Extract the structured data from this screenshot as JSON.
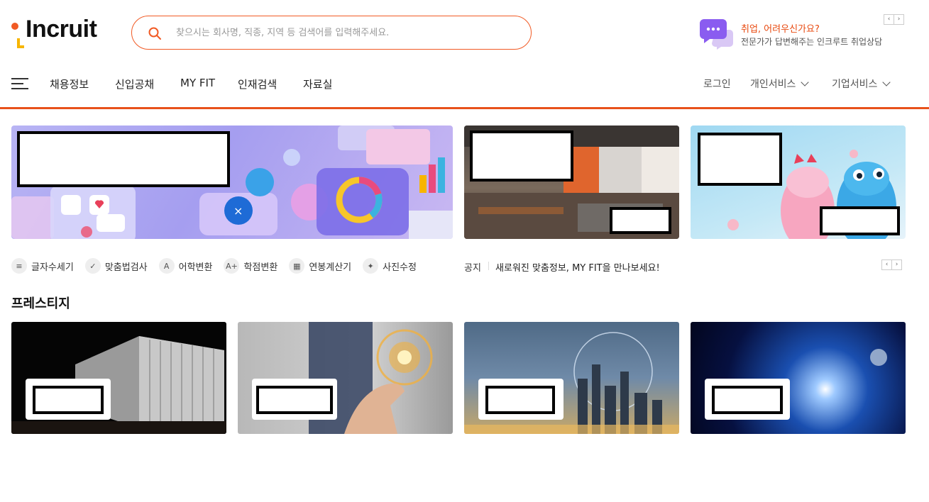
{
  "header": {
    "logo_text": "Incruit",
    "search_placeholder": "찾으시는 회사명, 직종, 지역 등 검색어를 입력해주세요.",
    "consult_title": "취업, 어려우신가요?",
    "consult_subtitle": "전문가가 답변해주는 인크루트 취업상담"
  },
  "nav": {
    "items": [
      "채용정보",
      "신입공채",
      "MY FIT",
      "인재검색",
      "자료실"
    ],
    "login": "로그인",
    "personal": "개인서비스",
    "business": "기업서비스"
  },
  "tools": [
    {
      "label": "글자수세기",
      "icon": "text-lines-icon"
    },
    {
      "label": "맞춤법검사",
      "icon": "spell-check-icon"
    },
    {
      "label": "어학변환",
      "icon": "language-icon"
    },
    {
      "label": "학점변환",
      "icon": "grade-icon"
    },
    {
      "label": "연봉계산기",
      "icon": "calculator-icon"
    },
    {
      "label": "사진수정",
      "icon": "magic-wand-icon"
    }
  ],
  "notice": {
    "label": "공지",
    "text": "새로워진 맞춤정보, MY FIT을 만나보세요!"
  },
  "prestige": {
    "title": "프레스티지"
  },
  "arrows": {
    "prev": "‹",
    "next": "›"
  },
  "colors": {
    "brand": "#e8521b",
    "accent": "#f7b500"
  }
}
